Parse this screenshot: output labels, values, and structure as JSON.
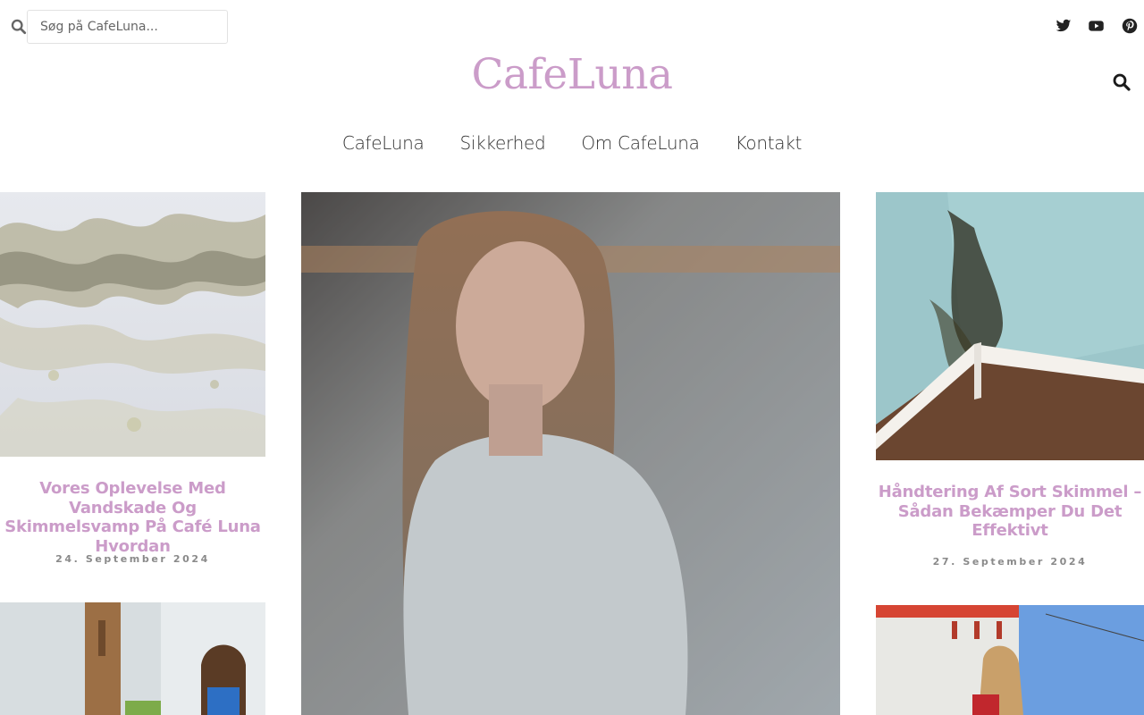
{
  "search": {
    "placeholder": "Søg på CafeLuna..."
  },
  "social": {
    "icons": [
      "twitter-icon",
      "youtube-icon",
      "pinterest-icon"
    ]
  },
  "site": {
    "logo": "CafeLuna"
  },
  "nav": {
    "items": [
      "CafeLuna",
      "Sikkerhed",
      "Om CafeLuna",
      "Kontakt"
    ]
  },
  "posts": [
    {
      "title": "Vores Oplevelse Med Vandskade Og Skimmelsvamp På Café Luna Hvordan",
      "date": "24. September 2024"
    },
    {
      "title": "Håndtering Af Sort Skimmel – Sådan Bekæmper Du Det Effektivt",
      "date": "27. September 2024"
    }
  ],
  "colors": {
    "brand": "#cb9cc9",
    "date": "#8a8a8a",
    "nav": "#333333"
  }
}
